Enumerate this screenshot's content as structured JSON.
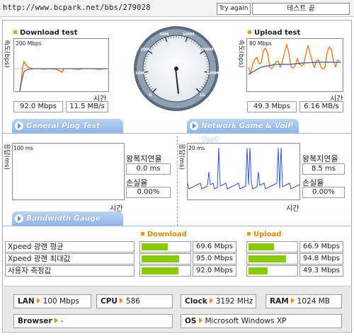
{
  "url": "http://www.bcpark.net/bbs/279028",
  "try_again_label": "Try again",
  "test_status": "테스트 끝",
  "download": {
    "title": "Download test",
    "axis_unit": "속도(bps)",
    "scale": "200 Mbps",
    "time_label": "시간",
    "speed_mbps": "92.0 Mbps",
    "speed_mbs": "11.5 MB/s",
    "line_color": "#ff6600",
    "avg_color": "#3355aa"
  },
  "upload": {
    "title": "Upload test",
    "axis_unit": "속도(bps)",
    "scale": "80 Mbps",
    "time_label": "시간",
    "speed_mbps": "49.3 Mbps",
    "speed_mbs": "6.16 MB/s",
    "line_color": "#ff6600",
    "avg_color": "#3355aa"
  },
  "gauge": {
    "tick_labels": [
      "0",
      "10M",
      "20M",
      "50M",
      "100M",
      "200M",
      "500M",
      "1G"
    ],
    "needle_value": "92.0 Mbps"
  },
  "ping_tab": {
    "label": "General Ping Test"
  },
  "game_tab": {
    "label": "Network Game & VoIP Test"
  },
  "ping_test": {
    "axis_unit": "응답(ms)",
    "scale": "100 ms",
    "time_label": "시간",
    "latency_label": "왕복지연율",
    "latency_value": "0.0 ms",
    "loss_label": "손실율",
    "loss_value": "0.00%"
  },
  "game_test": {
    "axis_unit": "응답(ms)",
    "scale": "20 ms",
    "time_label": "시간",
    "latency_label": "왕복지연율",
    "latency_value": "8.5 ms",
    "loss_label": "손실율",
    "loss_value": "0.00%",
    "line_color": "#3355cc"
  },
  "bandwidth_tab": {
    "label": "Bandwidth Gauge"
  },
  "bandwidth": {
    "download_head": "Download",
    "upload_head": "Upload",
    "rows": [
      {
        "label": "Xpeed 광랜 평균",
        "down_value": "69.6 Mbps",
        "down_fraction": 0.55,
        "up_value": "66.9 Mbps",
        "up_fraction": 0.54
      },
      {
        "label": "Xpeed 광랜 최대값",
        "down_value": "95.0 Mbps",
        "down_fraction": 0.79,
        "up_value": "94.8 Mbps",
        "up_fraction": 0.79
      },
      {
        "label": "사용자 측정값",
        "down_value": "92.0 Mbps",
        "down_fraction": 0.77,
        "up_value": "49.3 Mbps",
        "up_fraction": 0.4
      }
    ],
    "bar_color": "#88cc00"
  },
  "sysinfo": {
    "lan_key": "LAN",
    "lan_value": "100 Mbps",
    "cpu_key": "CPU",
    "cpu_value": "586",
    "clock_key": "Clock",
    "clock_value": "3192 MHz",
    "ram_key": "RAM",
    "ram_value": "1024 MB",
    "browser_key": "Browser",
    "browser_value": "-",
    "os_key": "OS",
    "os_value": "Microsoft Windows XP"
  }
}
